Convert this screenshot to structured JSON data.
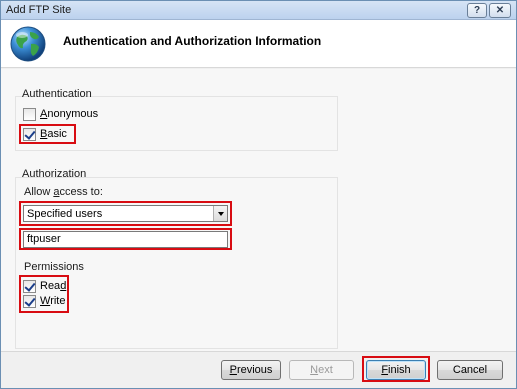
{
  "window": {
    "title": "Add FTP Site",
    "help_glyph": "?",
    "close_glyph": "✕"
  },
  "header": {
    "title": "Authentication and Authorization Information",
    "icon": "globe-icon"
  },
  "authentication": {
    "label": "Authentication",
    "anonymous": {
      "prefix": "",
      "mnemonic": "A",
      "rest": "nonymous",
      "checked": false
    },
    "basic": {
      "prefix": "",
      "mnemonic": "B",
      "rest": "asic",
      "checked": true
    }
  },
  "authorization": {
    "label": "Authorization",
    "allow_prefix": "Allow ",
    "allow_mnemonic": "a",
    "allow_rest": "ccess to:",
    "selected": "Specified users",
    "users_value": "ftpuser"
  },
  "permissions": {
    "label": "Permissions",
    "read": {
      "prefix": "Rea",
      "mnemonic": "d",
      "rest": "",
      "checked": true
    },
    "write": {
      "prefix": "",
      "mnemonic": "W",
      "rest": "rite",
      "checked": true
    }
  },
  "buttons": {
    "previous": {
      "mnemonic": "P",
      "rest": "revious"
    },
    "next": {
      "mnemonic": "N",
      "rest": "ext"
    },
    "finish": {
      "mnemonic": "F",
      "rest": "inish"
    },
    "cancel": "Cancel"
  },
  "colors": {
    "highlight": "#d80c12",
    "title_bar": "#c7daf2"
  }
}
